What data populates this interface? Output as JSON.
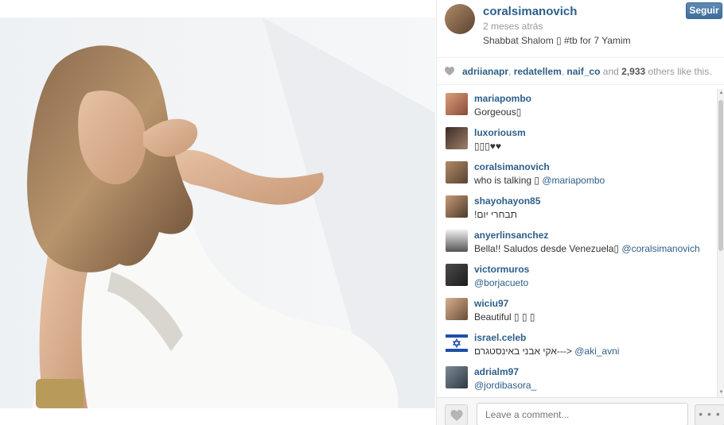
{
  "post": {
    "username": "coralsimanovich",
    "time": "2 meses atrás",
    "caption": "Shabbat Shalom ▯ #tb for 7 Yamim",
    "follow_label": "Seguir"
  },
  "likes": {
    "liker_1": "adriianapr",
    "liker_2": "redatellem",
    "liker_3": "naif_co",
    "and": "and",
    "count": "2,933",
    "suffix": "others like this."
  },
  "comments": [
    {
      "user": "mariapombo",
      "text": "Gorgeous▯",
      "mention": ""
    },
    {
      "user": "luxoriousm",
      "text": "▯▯▯♥♥",
      "mention": ""
    },
    {
      "user": "coralsimanovich",
      "text": "who is talking ▯ ",
      "mention": "@mariapombo"
    },
    {
      "user": "shayohayon85",
      "text": "!תבחרי יום",
      "mention": ""
    },
    {
      "user": "anyerlinsanchez",
      "text": "Bella!! Saludos desde Venezuela▯ ",
      "mention": "@coralsimanovich"
    },
    {
      "user": "victormuros",
      "text": "",
      "mention": "@borjacueto"
    },
    {
      "user": "wiciu97",
      "text": "Beautiful ▯ ▯ ▯",
      "mention": ""
    },
    {
      "user": "israel.celeb",
      "text": "אקי אבני באינסטגרם---> ",
      "mention": "@aki_avni"
    },
    {
      "user": "adrialm97",
      "text": "",
      "mention": "@jordibasora_"
    }
  ],
  "footer": {
    "comment_placeholder": "Leave a comment...",
    "more_label": "• • •"
  },
  "colors": {
    "link": "#2d5e8a",
    "follow_button": "#4a76a0"
  }
}
